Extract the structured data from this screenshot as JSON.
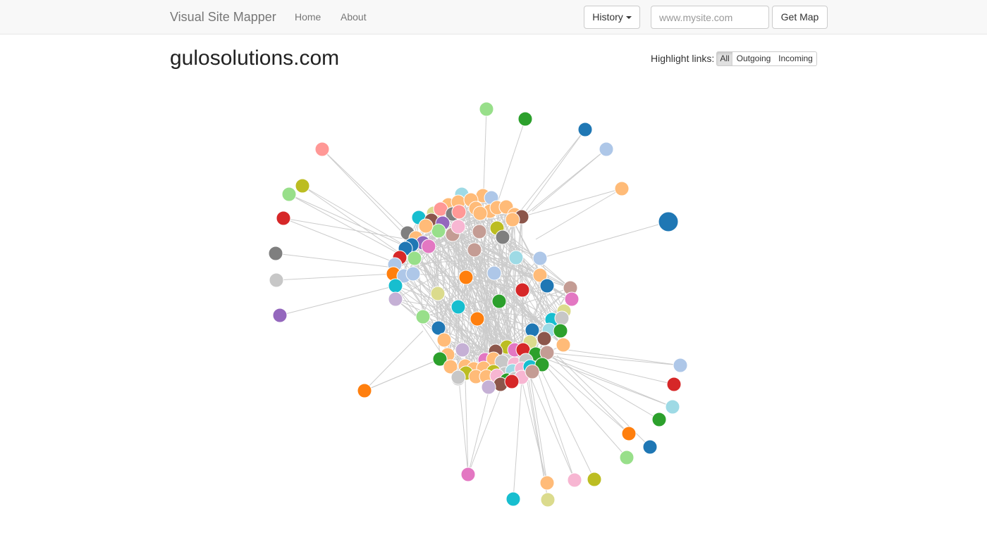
{
  "navbar": {
    "brand": "Visual Site Mapper",
    "links": [
      "Home",
      "About"
    ],
    "history_label": "History",
    "url_placeholder": "www.mysite.com",
    "get_map_label": "Get Map"
  },
  "page": {
    "title": "gulosolutions.com",
    "highlight_label": "Highlight links:",
    "highlight_options": [
      "All",
      "Outgoing",
      "Incoming"
    ],
    "highlight_selected": "All"
  },
  "palette": [
    "#1f77b4",
    "#aec7e8",
    "#ff7f0e",
    "#ffbb78",
    "#2ca02c",
    "#98df8a",
    "#d62728",
    "#ff9896",
    "#9467bd",
    "#c5b0d5",
    "#8c564b",
    "#c49c94",
    "#e377c2",
    "#f7b6d2",
    "#7f7f7f",
    "#c7c7c7",
    "#bcbd22",
    "#dbdb8d",
    "#17becf",
    "#9edae5"
  ]
}
